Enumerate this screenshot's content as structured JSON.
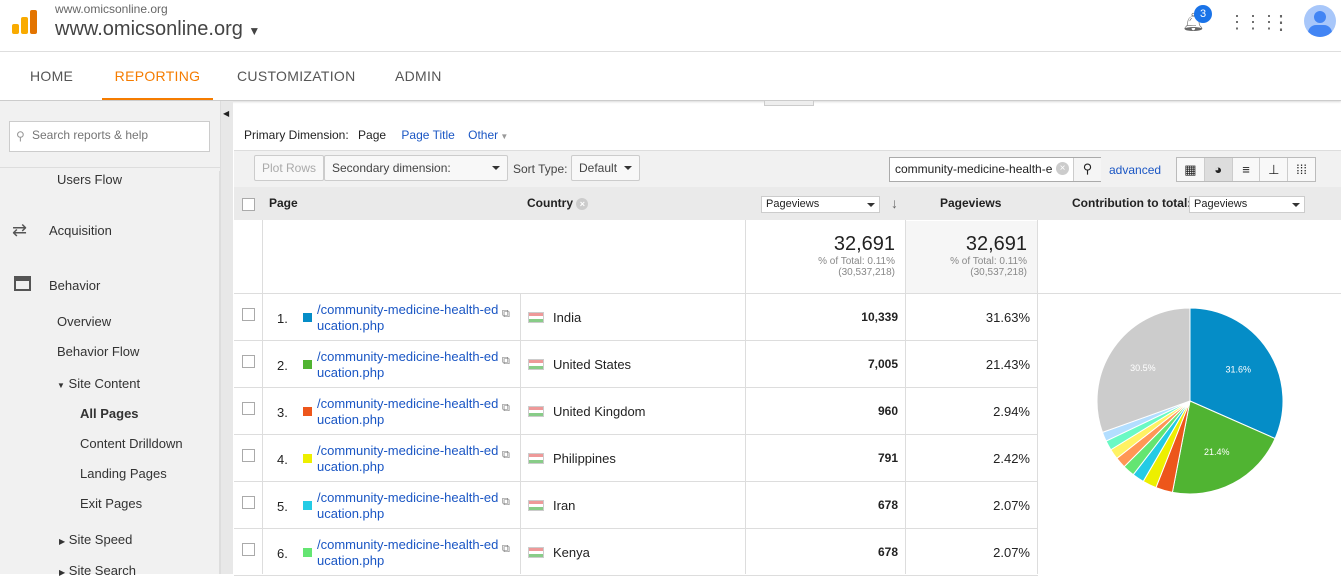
{
  "header": {
    "account": "www.omicsonline.org",
    "property": "www.omicsonline.org",
    "notification_count": "3"
  },
  "nav": {
    "tabs": [
      "HOME",
      "REPORTING",
      "CUSTOMIZATION",
      "ADMIN"
    ],
    "active": "REPORTING"
  },
  "sidebar": {
    "search_placeholder": "Search reports & help",
    "items": {
      "users_flow": "Users Flow",
      "acquisition": "Acquisition",
      "behavior": "Behavior",
      "overview": "Overview",
      "behavior_flow": "Behavior Flow",
      "site_content": "Site Content",
      "all_pages": "All Pages",
      "content_drilldown": "Content Drilldown",
      "landing_pages": "Landing Pages",
      "exit_pages": "Exit Pages",
      "site_speed": "Site Speed",
      "site_search": "Site Search"
    }
  },
  "dimension": {
    "label": "Primary Dimension:",
    "active": "Page",
    "page_title": "Page Title",
    "other": "Other"
  },
  "toolbar": {
    "plot_rows": "Plot Rows",
    "secondary": "Secondary dimension: Country",
    "sort_label": "Sort Type:",
    "sort_value": "Default",
    "search_value": "community-medicine-health-e",
    "advanced": "advanced"
  },
  "table": {
    "headers": {
      "page": "Page",
      "country": "Country",
      "metric_select": "Pageviews",
      "pageviews": "Pageviews",
      "contribution": "Contribution to total:",
      "contribution_select": "Pageviews"
    },
    "totals": {
      "value1": "32,691",
      "pct1": "% of Total: 0.11%",
      "total1": "(30,537,218)",
      "value2": "32,691",
      "pct2": "% of Total: 0.11%",
      "total2": "(30,537,218)"
    },
    "rows": [
      {
        "n": "1.",
        "page": "/community-medicine-health-education.php",
        "country": "India",
        "pageviews": "10,339",
        "pct": "31.63%",
        "color": "#058dc7"
      },
      {
        "n": "2.",
        "page": "/community-medicine-health-education.php",
        "country": "United States",
        "pageviews": "7,005",
        "pct": "21.43%",
        "color": "#50b432"
      },
      {
        "n": "3.",
        "page": "/community-medicine-health-education.php",
        "country": "United Kingdom",
        "pageviews": "960",
        "pct": "2.94%",
        "color": "#ed561b"
      },
      {
        "n": "4.",
        "page": "/community-medicine-health-education.php",
        "country": "Philippines",
        "pageviews": "791",
        "pct": "2.42%",
        "color": "#edef00"
      },
      {
        "n": "5.",
        "page": "/community-medicine-health-education.php",
        "country": "Iran",
        "pageviews": "678",
        "pct": "2.07%",
        "color": "#24cbe5"
      },
      {
        "n": "6.",
        "page": "/community-medicine-health-education.php",
        "country": "Kenya",
        "pageviews": "678",
        "pct": "2.07%",
        "color": "#64e572"
      }
    ]
  },
  "chart_data": {
    "type": "pie",
    "values": [
      31.63,
      21.43,
      2.94,
      2.42,
      2.07,
      2.07,
      1.9,
      1.8,
      1.7,
      1.6,
      30.5
    ],
    "colors": [
      "#058dc7",
      "#50b432",
      "#ed561b",
      "#edef00",
      "#24cbe5",
      "#64e572",
      "#ff9655",
      "#fff263",
      "#6af9c4",
      "#b2deff",
      "#cccccc"
    ],
    "labels": [
      "31.6%",
      "21.4%",
      "",
      "",
      "",
      "",
      "",
      "",
      "",
      "",
      "30.5%"
    ]
  }
}
